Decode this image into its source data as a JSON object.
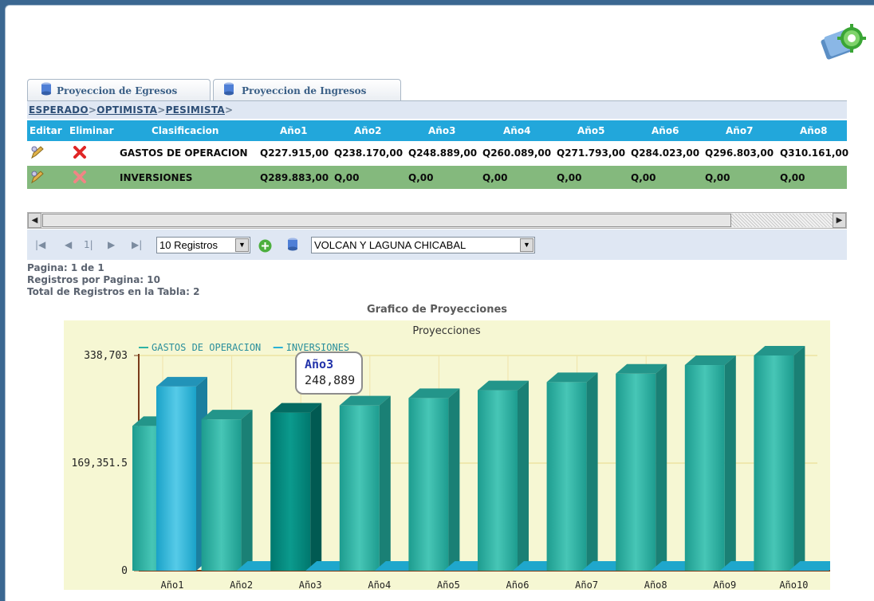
{
  "tabs": [
    {
      "label": "Proyeccion de Egresos"
    },
    {
      "label": "Proyeccion de Ingresos"
    }
  ],
  "breadcrumb": {
    "items": [
      "ESPERADO",
      "OPTIMISTA",
      "PESIMISTA"
    ],
    "separator": ">"
  },
  "table": {
    "headers": [
      "Editar",
      "Eliminar",
      "Clasificacion",
      "Año1",
      "Año2",
      "Año3",
      "Año4",
      "Año5",
      "Año6",
      "Año7",
      "Año8"
    ],
    "rows": [
      {
        "clasificacion": "GASTOS DE OPERACION",
        "values": [
          "Q227.915,00",
          "Q238.170,00",
          "Q248.889,00",
          "Q260.089,00",
          "Q271.793,00",
          "Q284.023,00",
          "Q296.803,00",
          "Q310.161,00"
        ]
      },
      {
        "clasificacion": "INVERSIONES",
        "values": [
          "Q289.883,00",
          "Q,00",
          "Q,00",
          "Q,00",
          "Q,00",
          "Q,00",
          "Q,00",
          "Q,00"
        ]
      }
    ]
  },
  "pager": {
    "current_page": "1|",
    "page_size": "10 Registros",
    "project": "VOLCAN Y LAGUNA CHICABAL"
  },
  "info": {
    "pagina": "Pagina: 1 de 1",
    "registros_por_pagina": "Registros por Pagina: 10",
    "total": "Total de Registros en la Tabla: 2"
  },
  "chart_section_title": "Grafico de Proyecciones",
  "chart_data": {
    "type": "bar",
    "title": "Proyecciones",
    "categories": [
      "Año1",
      "Año2",
      "Año3",
      "Año4",
      "Año5",
      "Año6",
      "Año7",
      "Año8",
      "Año9",
      "Año10"
    ],
    "series": [
      {
        "name": "GASTOS DE OPERACION",
        "color": "#2fb3a5",
        "values": [
          227915,
          238170,
          248889,
          260089,
          271793,
          284023,
          296803,
          310161,
          323620,
          338703
        ]
      },
      {
        "name": "INVERSIONES",
        "color": "#2ab2d6",
        "values": [
          289883,
          0,
          0,
          0,
          0,
          0,
          0,
          0,
          0,
          0
        ]
      }
    ],
    "yticks": [
      "0",
      "169,351.5",
      "338,703"
    ],
    "ylim": [
      0,
      338703
    ],
    "legend_position": "top-left",
    "highlight_index": 2,
    "tooltip": {
      "label": "Año3",
      "value": "248,889"
    }
  }
}
